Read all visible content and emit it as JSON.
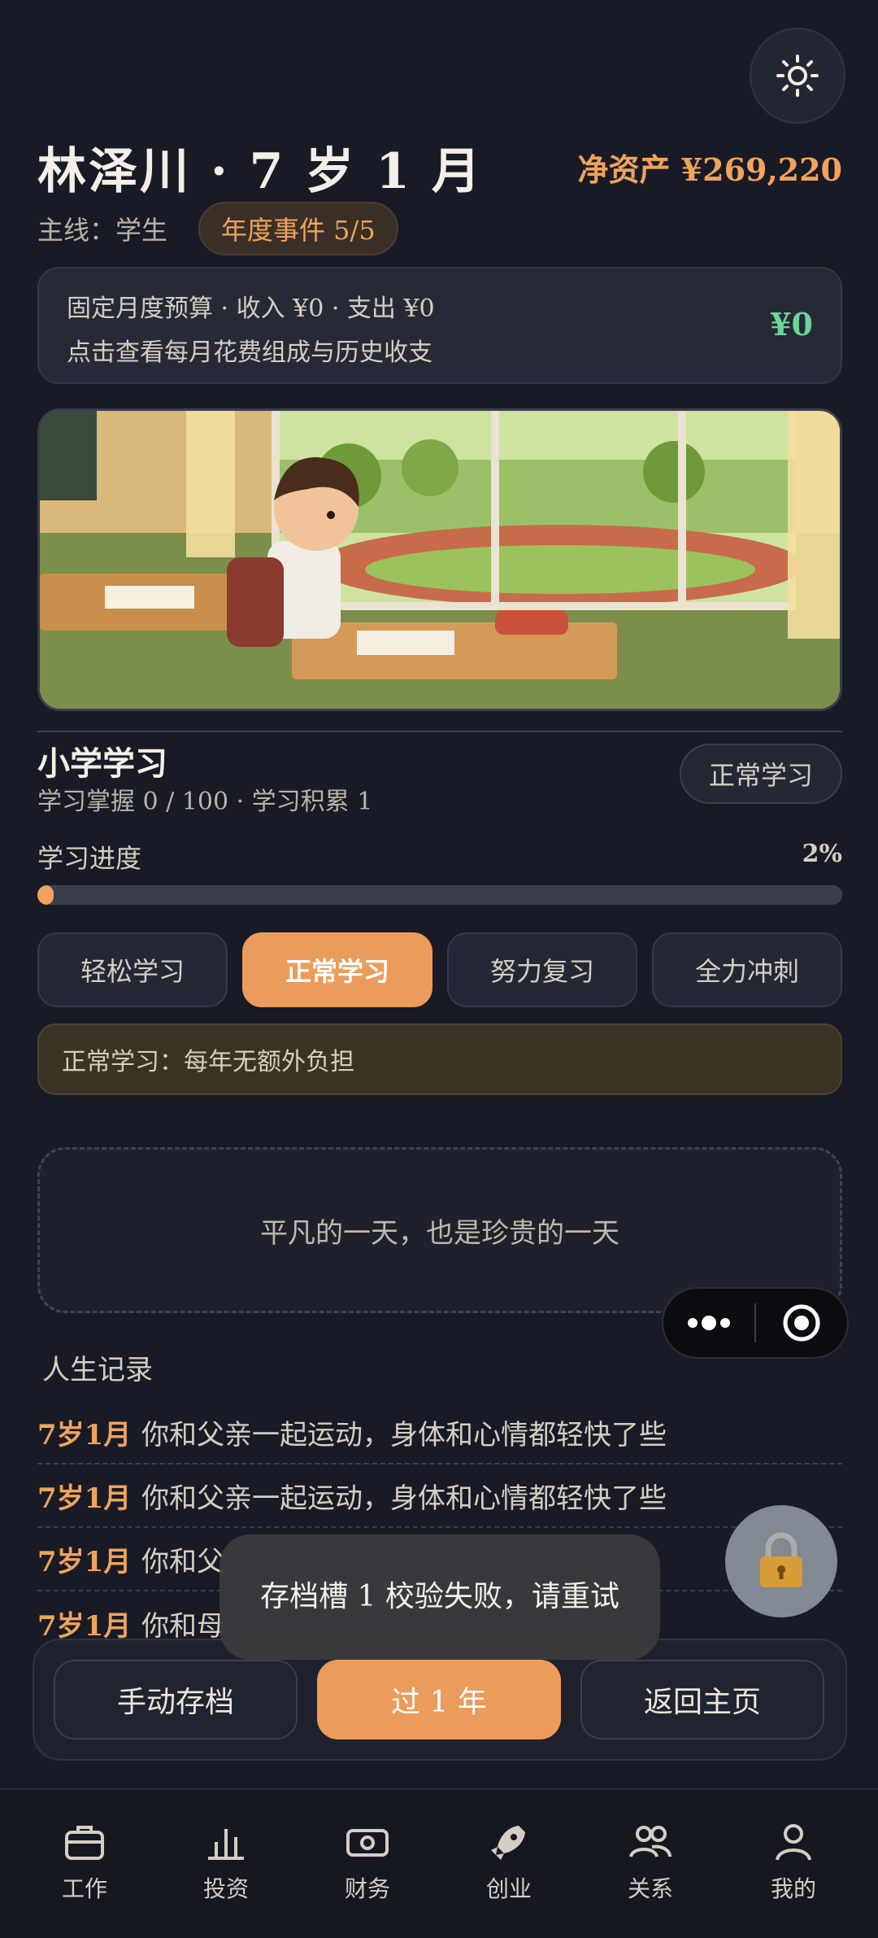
{
  "header": {
    "title": "林泽川 · 7 岁 1 月",
    "net_worth": "净资产 ¥269,220",
    "mainline": "主线：学生",
    "event_badge": "年度事件 5/5"
  },
  "budget": {
    "line1": "固定月度预算 · 收入 ¥0 · 支出 ¥0",
    "line2": "点击查看每月花费组成与历史收支",
    "value": "¥0"
  },
  "study": {
    "title": "小学学习",
    "subtitle": "学习掌握 0 / 100 · 学习积累 1",
    "mode_pill": "正常学习",
    "progress_label": "学习进度",
    "progress_text": "2%",
    "progress_value": 0.02,
    "options": [
      "轻松学习",
      "正常学习",
      "努力复习",
      "全力冲刺"
    ],
    "active_option": 1,
    "note": "正常学习：每年无额外负担"
  },
  "day_card": "平凡的一天，也是珍贵的一天",
  "records": {
    "title": "人生记录",
    "items": [
      {
        "age": "7岁1月",
        "text": "你和父亲一起运动，身体和心情都轻快了些"
      },
      {
        "age": "7岁1月",
        "text": "你和父亲一起运动，身体和心情都轻快了些"
      },
      {
        "age": "7岁1月",
        "text": "你和父"
      },
      {
        "age": "7岁1月",
        "text": "你和母"
      }
    ]
  },
  "toast": "存档槽 1 校验失败，请重试",
  "actions": {
    "save": "手动存档",
    "next_year": "过 1 年",
    "home": "返回主页"
  },
  "tabs": [
    {
      "label": "工作",
      "icon": "briefcase-icon"
    },
    {
      "label": "投资",
      "icon": "bar-chart-icon"
    },
    {
      "label": "财务",
      "icon": "cash-icon"
    },
    {
      "label": "创业",
      "icon": "rocket-icon"
    },
    {
      "label": "关系",
      "icon": "people-icon"
    },
    {
      "label": "我的",
      "icon": "user-icon"
    }
  ],
  "colors": {
    "accent": "#eb9c5c",
    "positive": "#6fd39a",
    "background": "#181b25"
  }
}
